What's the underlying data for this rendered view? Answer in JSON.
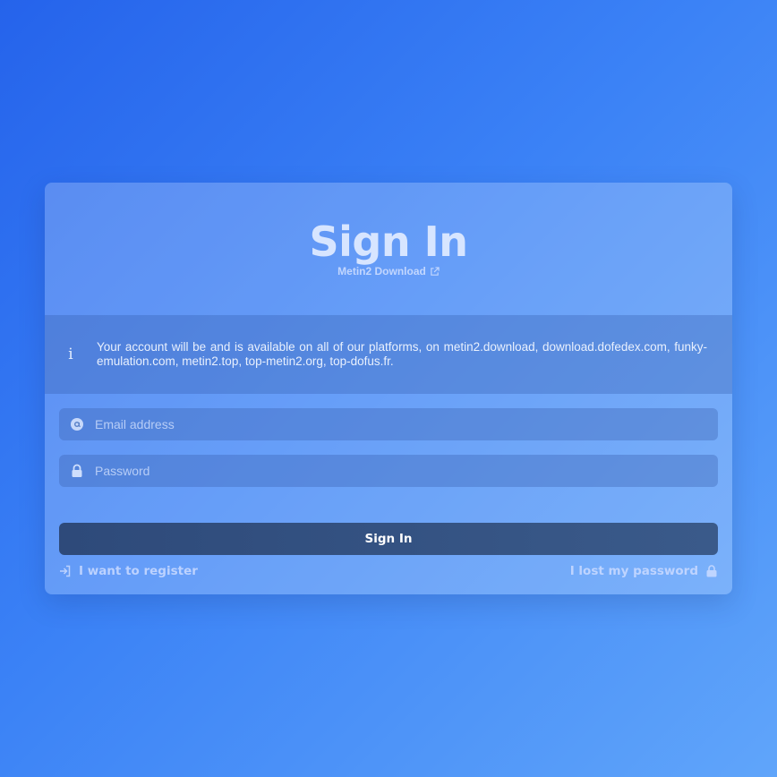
{
  "header": {
    "title": "Sign In",
    "subtitle_link": "Metin2 Download",
    "subtitle_icon": "external-link-icon"
  },
  "info": {
    "icon": "info-icon",
    "text": "Your account will be and is available on all of our platforms, on metin2.download, download.dofedex.com, funky-emulation.com, metin2.top, top-metin2.org, top-dofus.fr."
  },
  "form": {
    "email": {
      "icon": "at-icon",
      "placeholder": "Email address",
      "value": ""
    },
    "password": {
      "icon": "lock-icon",
      "placeholder": "Password",
      "value": ""
    },
    "submit_label": "Sign In"
  },
  "footer": {
    "register_label": "I want to register",
    "register_icon": "sign-in-arrow-icon",
    "lost_password_label": "I lost my password",
    "lost_password_icon": "unlock-icon"
  },
  "colors": {
    "background_start": "#2563eb",
    "background_end": "#60a5fa",
    "button": "#2e4a7a"
  }
}
